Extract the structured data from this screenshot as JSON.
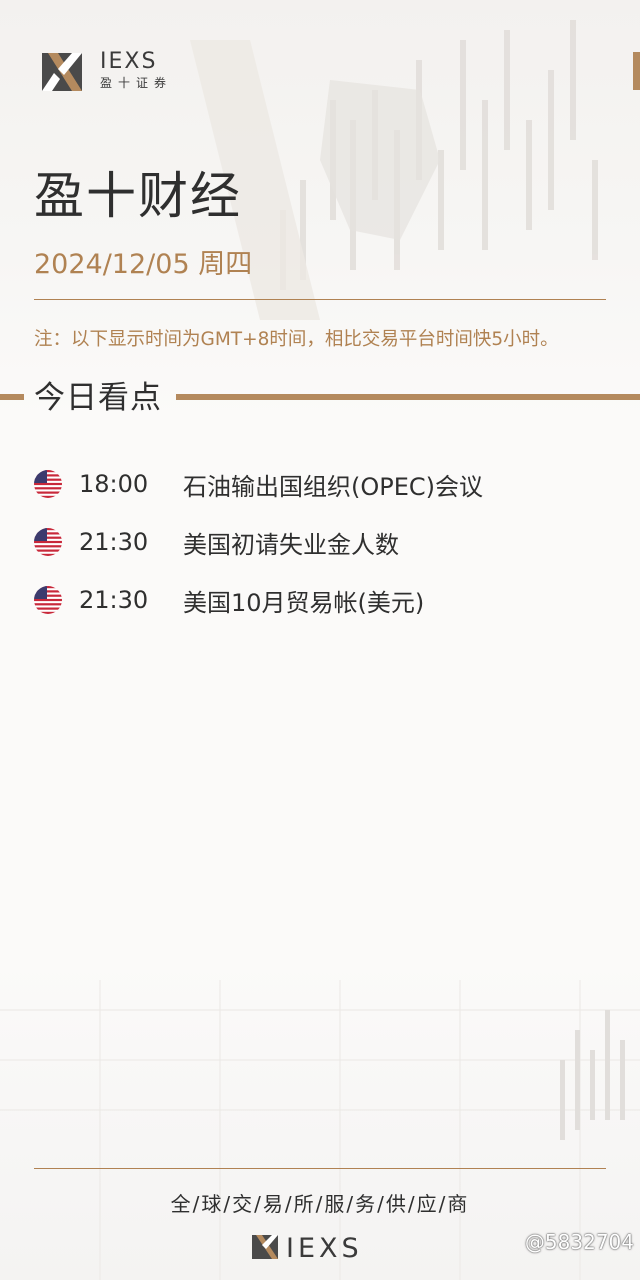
{
  "brand": {
    "logo_word": "IEXS",
    "logo_sub": "盈十证券",
    "accent_color": "#b08252",
    "text_color": "#2f2f2f"
  },
  "header": {
    "title": "盈十财经",
    "date": "2024/12/05 周四",
    "note": "注：以下显示时间为GMT+8时间，相比交易平台时间快5小时。"
  },
  "section": {
    "title": "今日看点"
  },
  "events": [
    {
      "flag": "us-flag-icon",
      "time": "18:00",
      "title": "石油输出国组织(OPEC)会议"
    },
    {
      "flag": "us-flag-icon",
      "time": "21:30",
      "title": "美国初请失业金人数"
    },
    {
      "flag": "us-flag-icon",
      "time": "21:30",
      "title": "美国10月贸易帐(美元)"
    }
  ],
  "footer": {
    "tagline": "全/球/交/易/所/服/务/供/应/商",
    "logo_word": "IEXS",
    "watermark": "@5832704"
  }
}
